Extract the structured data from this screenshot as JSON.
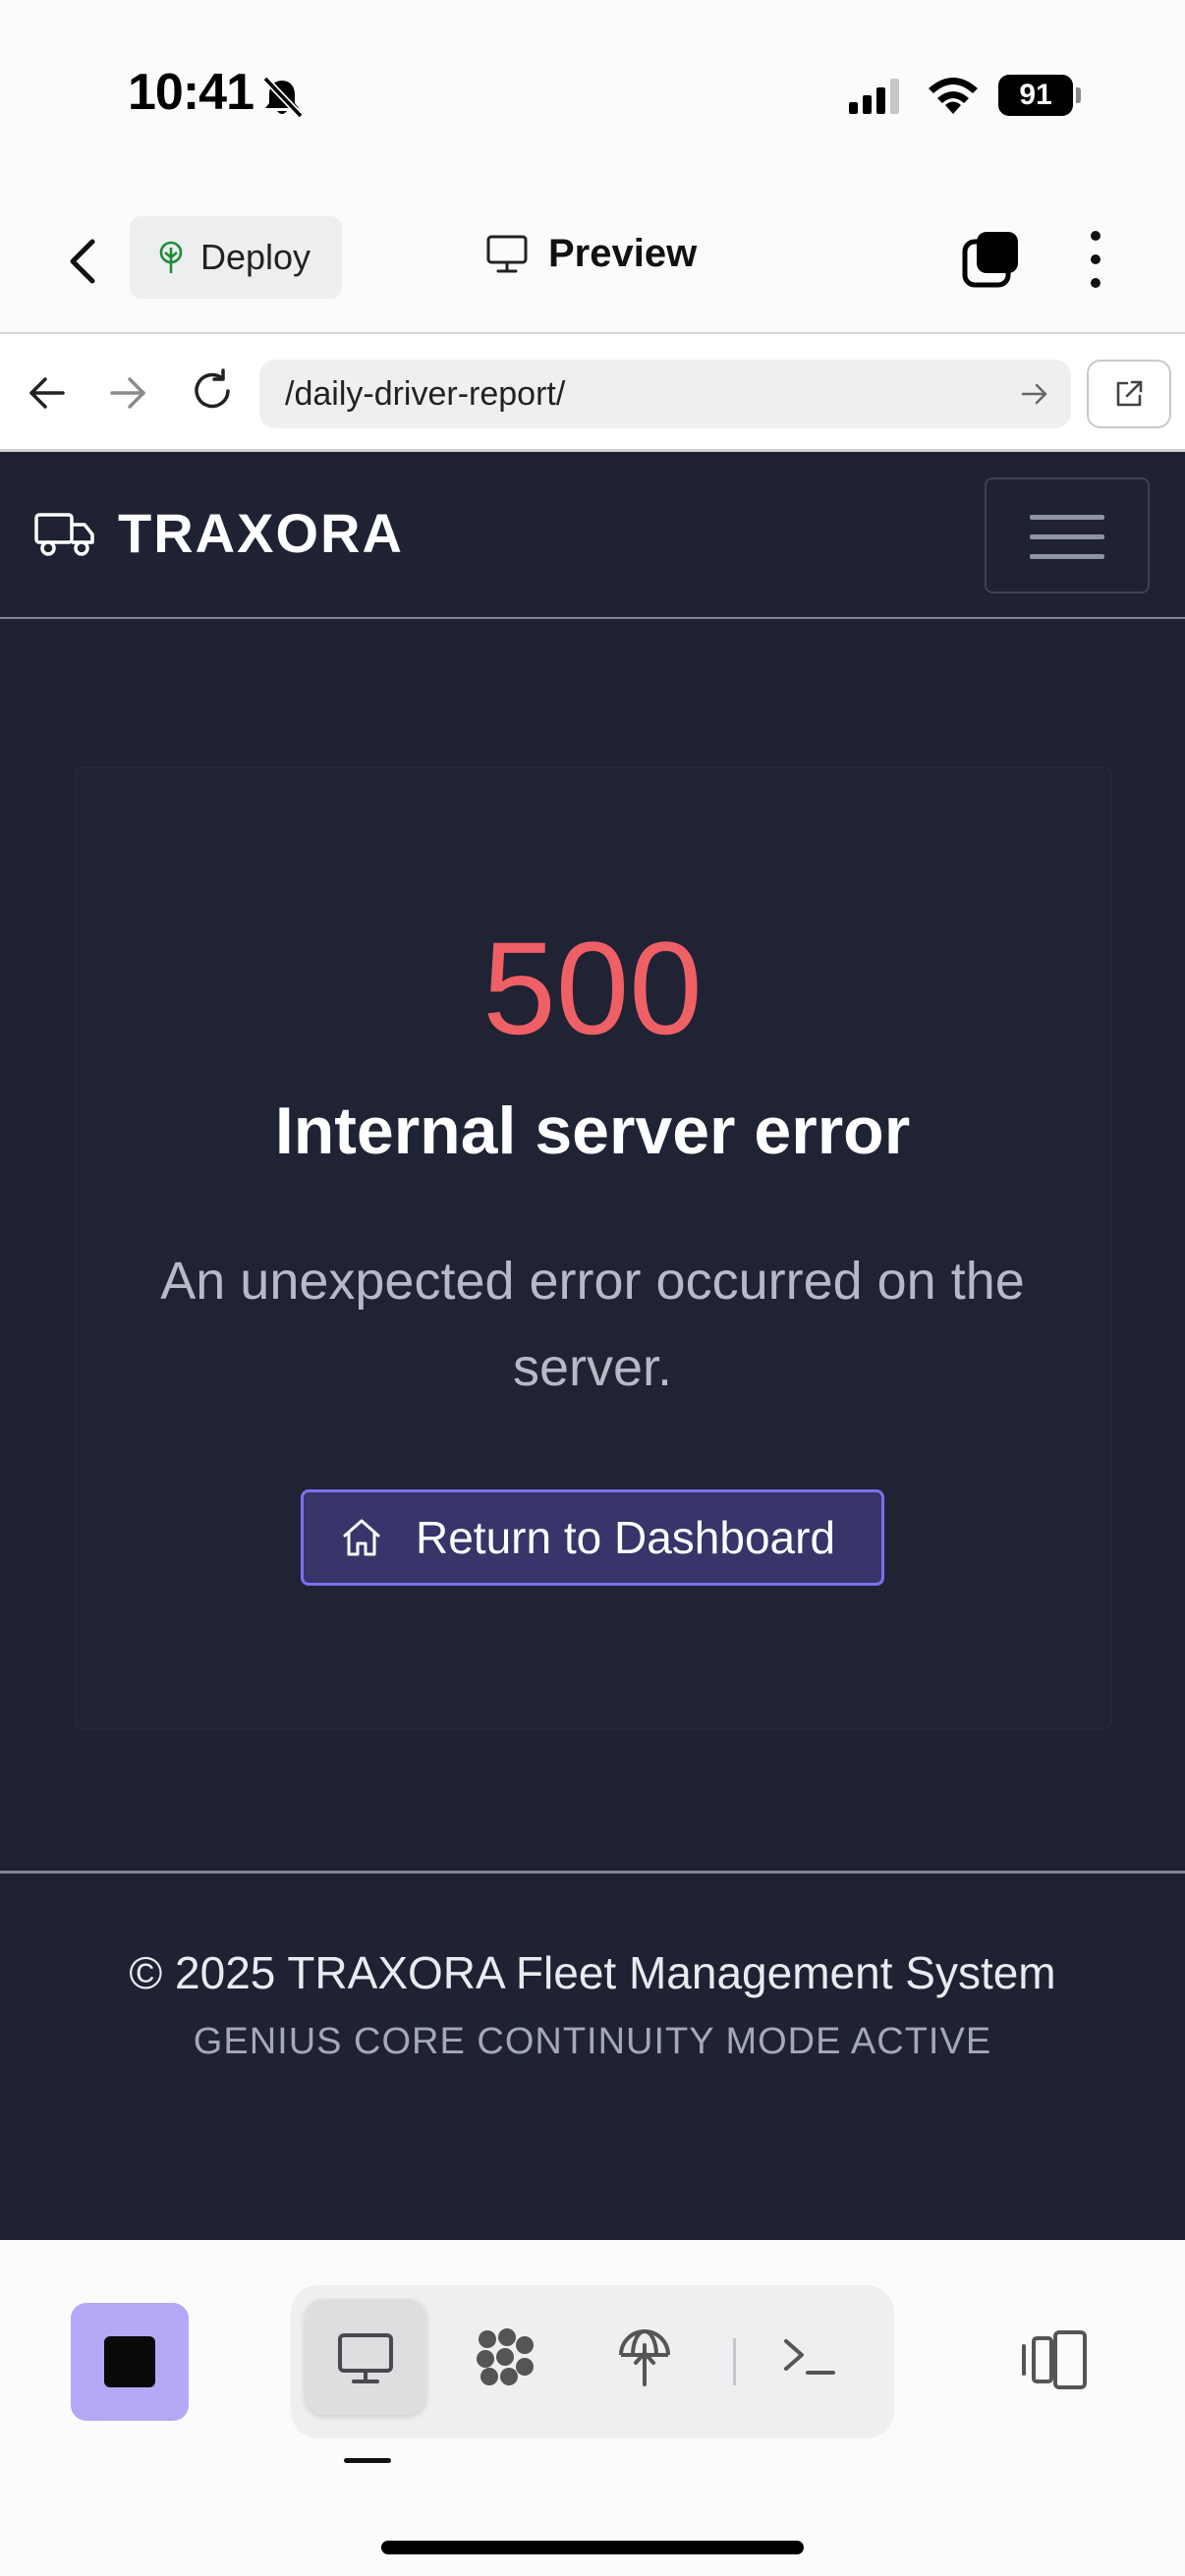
{
  "status_bar": {
    "time": "10:41",
    "battery": "91"
  },
  "app_bar": {
    "deploy_label": "Deploy",
    "title": "Preview"
  },
  "browser": {
    "url": "/daily-driver-report/"
  },
  "site": {
    "brand": "TRAXORA",
    "error": {
      "code": "500",
      "title": "Internal server error",
      "message": "An unexpected error occurred on the server.",
      "button_label": "Return to Dashboard"
    },
    "footer": {
      "copyright": "© 2025 TRAXORA Fleet Management System",
      "mode": "GENIUS CORE CONTINUITY MODE ACTIVE"
    }
  },
  "colors": {
    "page_bg": "#1e2232",
    "error_code": "#ef5f66",
    "button_bg": "#37356a",
    "button_border": "#7b70ee",
    "stop_button": "#b3a9f7"
  },
  "bottom_bar": {
    "items": [
      "monitor-icon",
      "cluster-icon",
      "deploy-icon",
      "terminal-icon"
    ],
    "active": "monitor-icon"
  }
}
